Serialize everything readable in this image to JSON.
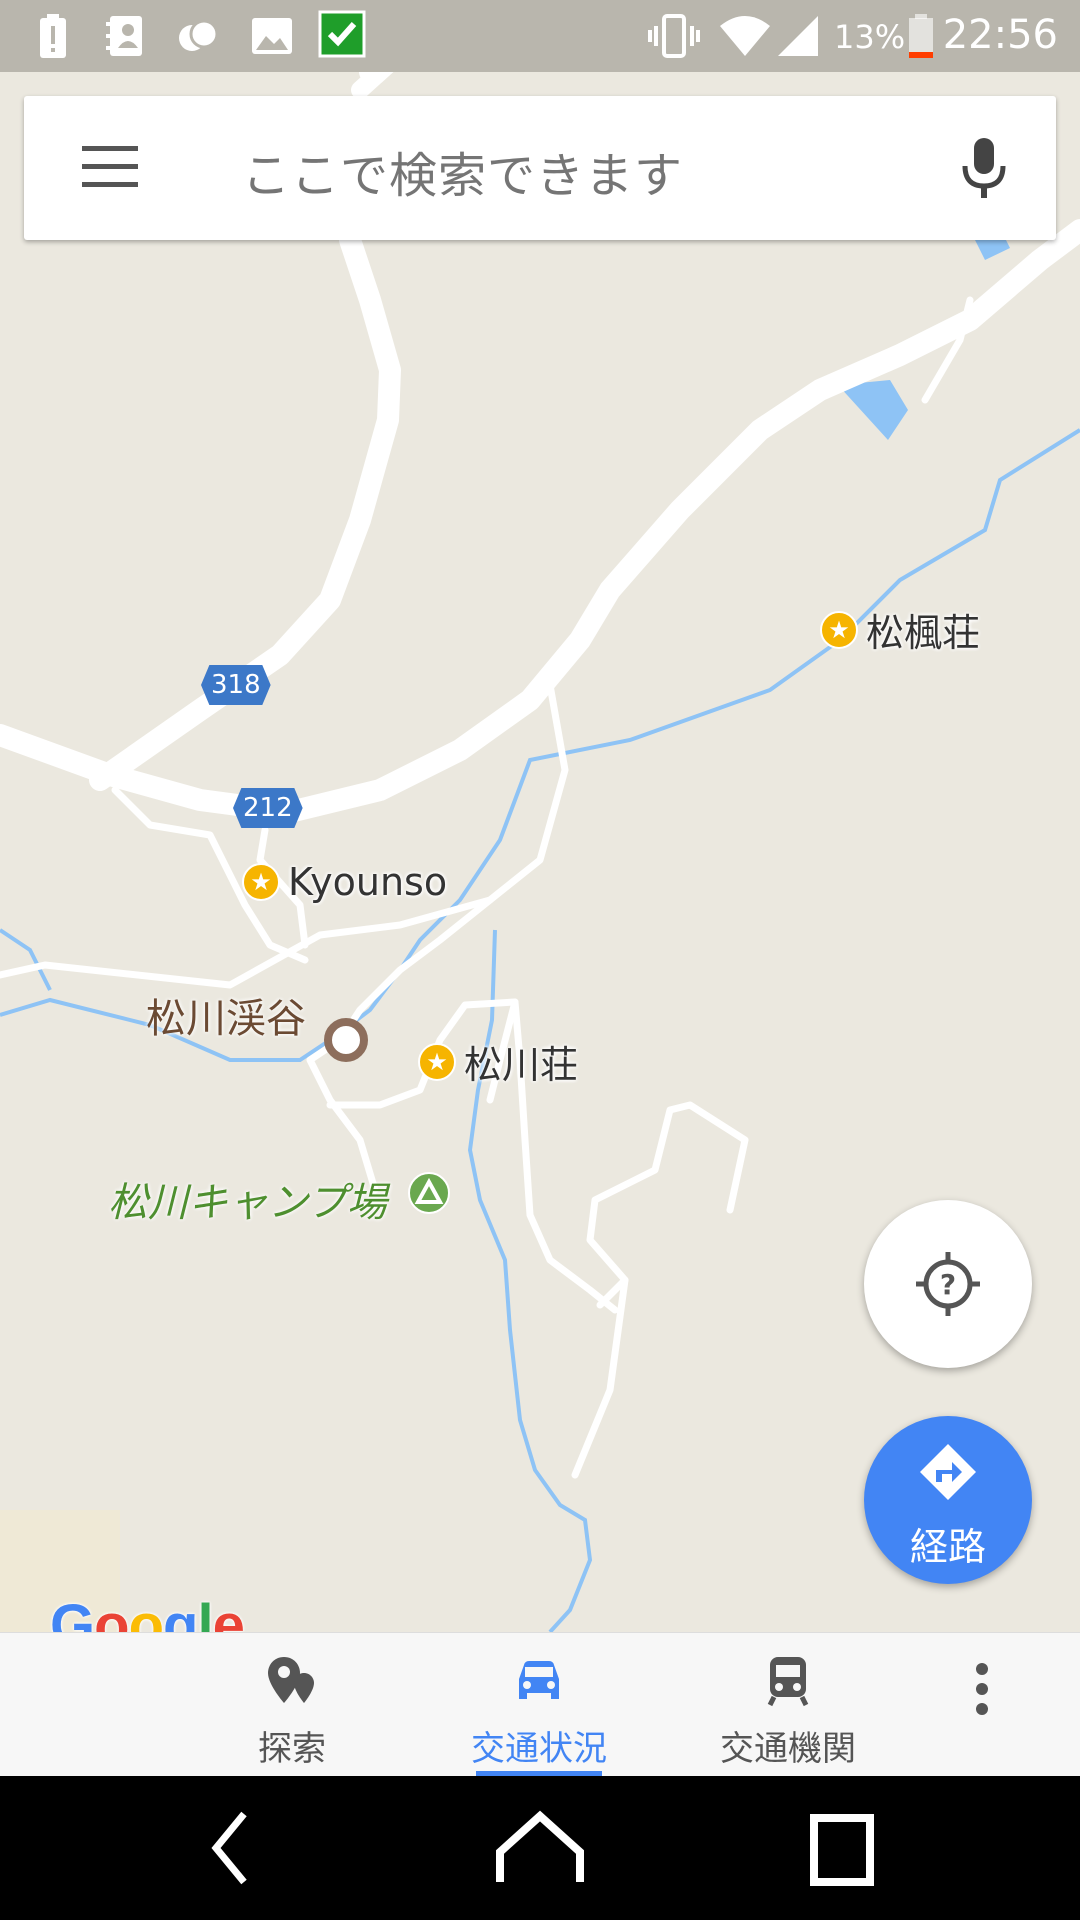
{
  "status_bar": {
    "battery_percent": "13%",
    "time": "22:56",
    "icons": [
      "battery-alert-icon",
      "contacts-icon",
      "social-icon",
      "image-icon",
      "checkmark-app-icon",
      "vibrate-icon",
      "wifi-icon",
      "signal-icon",
      "battery-icon"
    ]
  },
  "search": {
    "placeholder": "ここで検索できます",
    "menu_icon": "hamburger-menu-icon",
    "mic_icon": "microphone-icon"
  },
  "map": {
    "pois": [
      {
        "name": "松楓荘",
        "icon": "star-poi-icon"
      },
      {
        "name": "Kyounso",
        "icon": "star-poi-icon"
      },
      {
        "name": "松川荘",
        "icon": "star-poi-icon"
      }
    ],
    "landmark": {
      "name": "松川渓谷",
      "icon": "landmark-dot-icon"
    },
    "campground": {
      "name": "松川キャンプ場",
      "icon": "campground-icon"
    },
    "route_shields": [
      "318",
      "212"
    ],
    "colors": {
      "road": "#ffffff",
      "water": "#8ec3f5",
      "land": "#ebe8df",
      "poi": "#f6b400"
    }
  },
  "fab": {
    "location_icon": "location-unknown-icon",
    "directions_label": "経路",
    "directions_icon": "directions-icon"
  },
  "logo": "Google",
  "tabs": [
    {
      "label": "探索",
      "icon": "explore-icon",
      "active": false
    },
    {
      "label": "交通状況",
      "icon": "car-icon",
      "active": true
    },
    {
      "label": "交通機関",
      "icon": "train-icon",
      "active": false
    }
  ],
  "overflow_icon": "more-vert-icon",
  "nav": [
    "back-icon",
    "home-icon",
    "recents-icon"
  ],
  "accent_color": "#4285f4"
}
